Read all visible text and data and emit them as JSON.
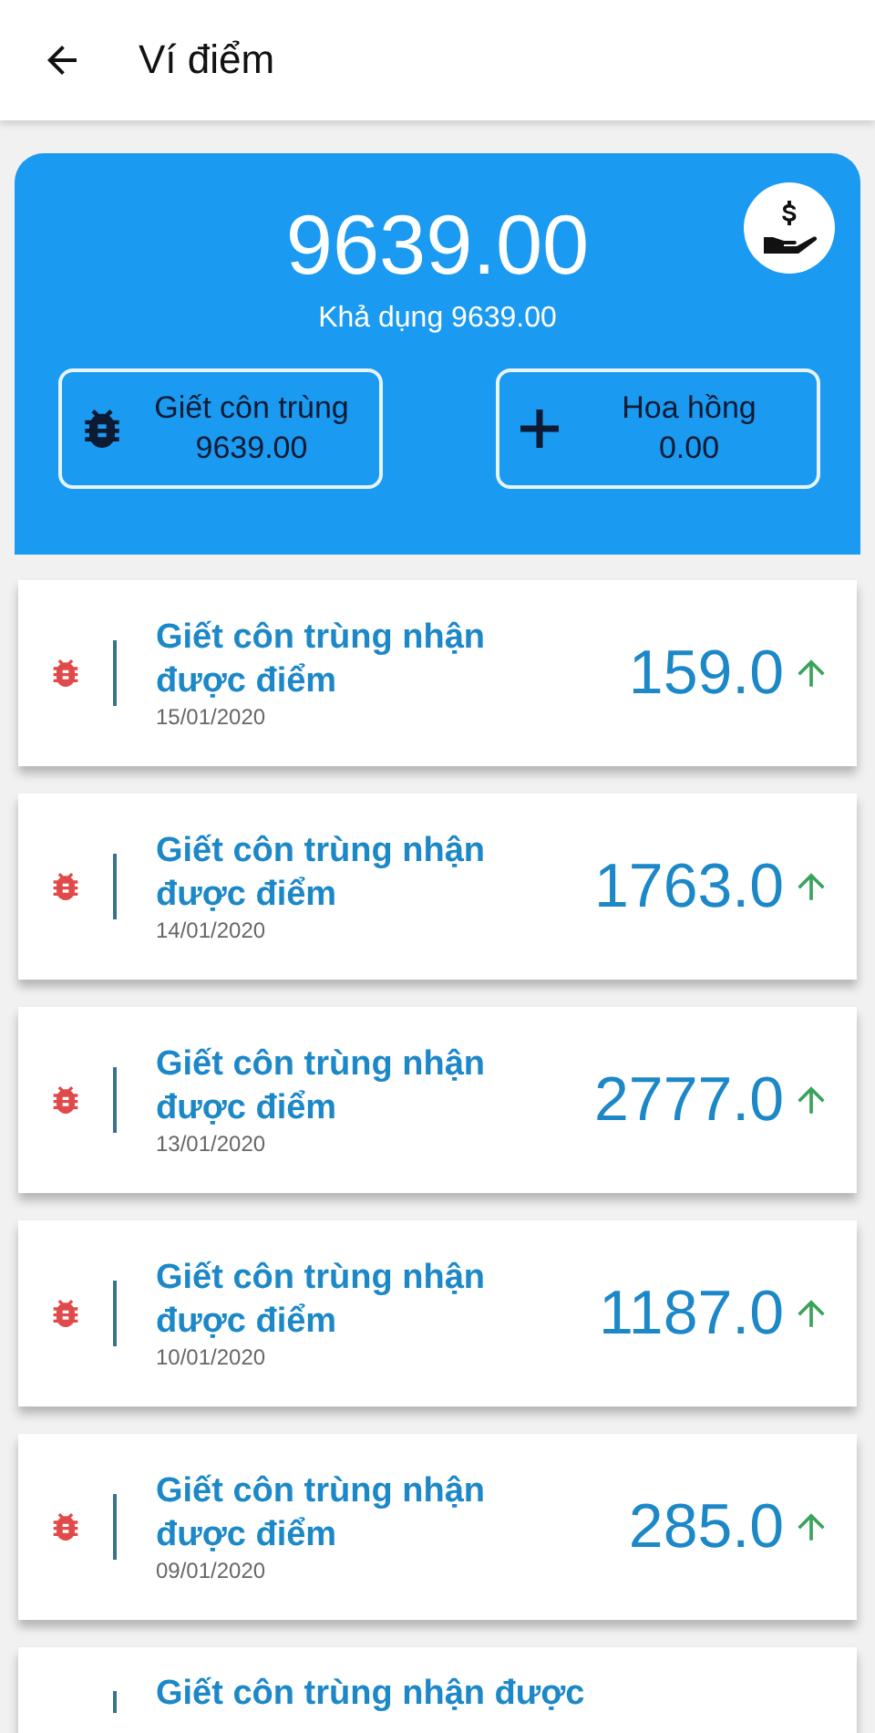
{
  "header": {
    "title": "Ví điểm"
  },
  "balance": {
    "amount": "9639.00",
    "available": "Khả dụng 9639.00",
    "buttons": [
      {
        "kind": "bug",
        "label": "Giết côn trùng",
        "value": "9639.00"
      },
      {
        "kind": "plus",
        "label": "Hoa hồng",
        "value": "0.00"
      }
    ]
  },
  "transactions": [
    {
      "title": "Giết côn trùng nhận được điểm",
      "date": "15/01/2020",
      "points": "159.0"
    },
    {
      "title": "Giết côn trùng nhận được điểm",
      "date": "14/01/2020",
      "points": "1763.0"
    },
    {
      "title": "Giết côn trùng nhận được điểm",
      "date": "13/01/2020",
      "points": "2777.0"
    },
    {
      "title": "Giết côn trùng nhận được điểm",
      "date": "10/01/2020",
      "points": "1187.0"
    },
    {
      "title": "Giết côn trùng nhận được điểm",
      "date": "09/01/2020",
      "points": "285.0"
    },
    {
      "title": "Giết côn trùng nhận được"
    }
  ]
}
